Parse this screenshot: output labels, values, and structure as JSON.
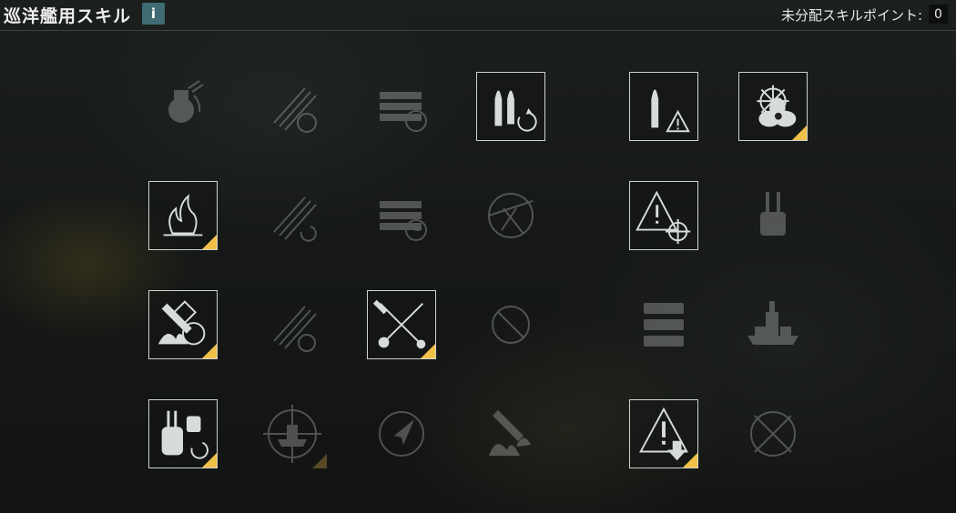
{
  "header": {
    "title": "巡洋艦用スキル",
    "info_label": "i",
    "points_label": "未分配スキルポイント:",
    "points_value": "0"
  },
  "skills": [
    {
      "icon": "turret-rotation-icon",
      "learned": false,
      "upgraded": false
    },
    {
      "icon": "torpedo-speed-icon",
      "learned": false,
      "upgraded": false
    },
    {
      "icon": "ammo-rack-reload-icon",
      "learned": false,
      "upgraded": false
    },
    {
      "icon": "shell-reload-icon",
      "learned": true,
      "upgraded": false
    },
    {
      "icon": "shell-warning-icon",
      "learned": true,
      "upgraded": false
    },
    {
      "icon": "helm-propeller-icon",
      "learned": true,
      "upgraded": true
    },
    {
      "icon": "fire-icon",
      "learned": true,
      "upgraded": true
    },
    {
      "icon": "torpedo-reload-icon",
      "learned": false,
      "upgraded": false
    },
    {
      "icon": "ammo-rack-timer-icon",
      "learned": false,
      "upgraded": false
    },
    {
      "icon": "aircraft-target-icon",
      "learned": false,
      "upgraded": false
    },
    {
      "icon": "warning-crosshair-icon",
      "learned": true,
      "upgraded": false
    },
    {
      "icon": "aa-turret-icon",
      "learned": false,
      "upgraded": false
    },
    {
      "icon": "shell-fire-gear-icon",
      "learned": true,
      "upgraded": true
    },
    {
      "icon": "torpedo-armament-icon",
      "learned": false,
      "upgraded": false
    },
    {
      "icon": "crossed-tools-icon",
      "learned": true,
      "upgraded": true
    },
    {
      "icon": "prohibited-icon",
      "learned": false,
      "upgraded": false
    },
    {
      "icon": "ammo-stack-icon",
      "learned": false,
      "upgraded": false
    },
    {
      "icon": "battleship-icon",
      "learned": false,
      "upgraded": false
    },
    {
      "icon": "turret-reload-icon",
      "learned": true,
      "upgraded": true
    },
    {
      "icon": "ship-crosshair-icon",
      "learned": false,
      "upgraded": true
    },
    {
      "icon": "compass-arrow-icon",
      "learned": false,
      "upgraded": false
    },
    {
      "icon": "fire-shell-icon",
      "learned": false,
      "upgraded": false
    },
    {
      "icon": "warning-download-icon",
      "learned": true,
      "upgraded": true
    },
    {
      "icon": "crossed-tools-circle-icon",
      "learned": false,
      "upgraded": false
    }
  ]
}
